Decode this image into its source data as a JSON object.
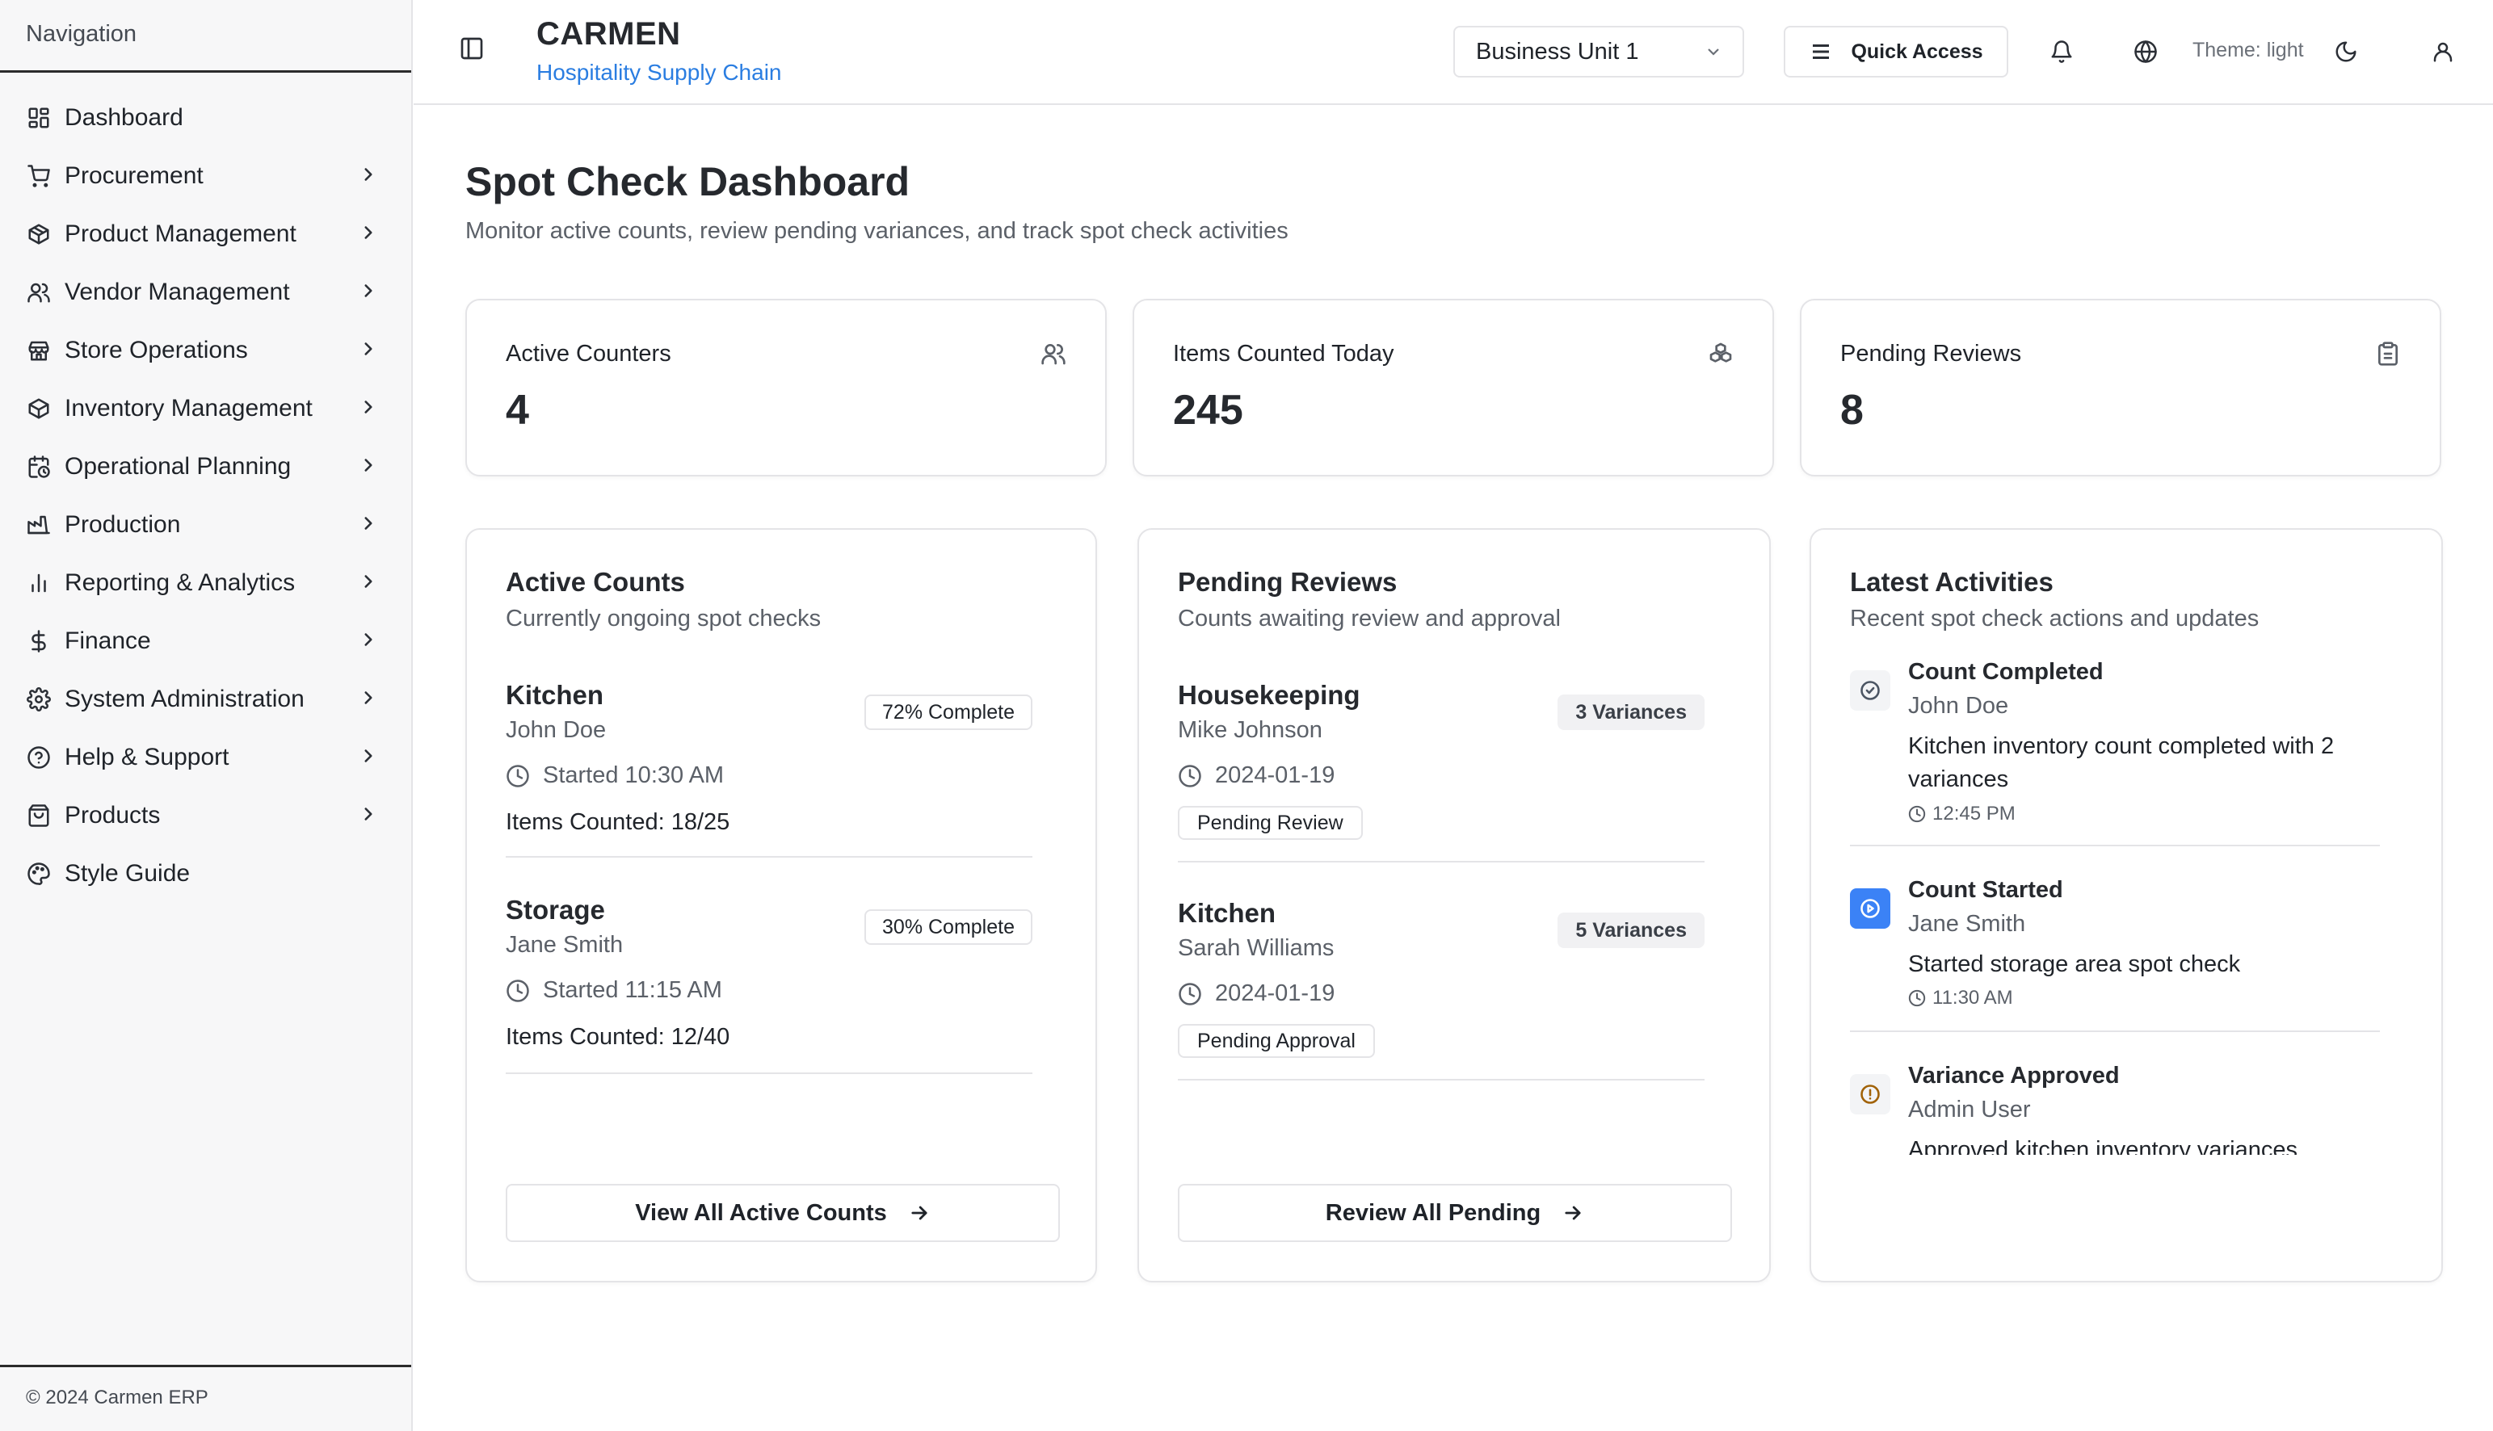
{
  "sidebar": {
    "heading": "Navigation",
    "items": [
      {
        "label": "Dashboard",
        "icon": "dashboard-icon",
        "chevron": false
      },
      {
        "label": "Procurement",
        "icon": "cart-icon",
        "chevron": true
      },
      {
        "label": "Product Management",
        "icon": "package-icon",
        "chevron": true
      },
      {
        "label": "Vendor Management",
        "icon": "users-icon",
        "chevron": true
      },
      {
        "label": "Store Operations",
        "icon": "store-icon",
        "chevron": true
      },
      {
        "label": "Inventory Management",
        "icon": "package-icon",
        "chevron": true
      },
      {
        "label": "Operational Planning",
        "icon": "calendar-clock-icon",
        "chevron": true
      },
      {
        "label": "Production",
        "icon": "factory-icon",
        "chevron": true
      },
      {
        "label": "Reporting & Analytics",
        "icon": "bar-chart-icon",
        "chevron": true
      },
      {
        "label": "Finance",
        "icon": "dollar-icon",
        "chevron": true
      },
      {
        "label": "System Administration",
        "icon": "gear-icon",
        "chevron": true
      },
      {
        "label": "Help & Support",
        "icon": "help-circle-icon",
        "chevron": true
      },
      {
        "label": "Products",
        "icon": "shopping-bag-icon",
        "chevron": true
      },
      {
        "label": "Style Guide",
        "icon": "palette-icon",
        "chevron": false
      }
    ],
    "footer": "© 2024 Carmen ERP"
  },
  "header": {
    "brand": "CARMEN",
    "subtitle": "Hospitality Supply Chain",
    "business_unit": "Business Unit 1",
    "quick_access": "Quick Access",
    "theme_label": "Theme: light"
  },
  "page": {
    "title": "Spot Check Dashboard",
    "subtitle": "Monitor active counts, review pending variances, and track spot check activities"
  },
  "stats": [
    {
      "label": "Active Counters",
      "value": "4",
      "icon": "users-icon"
    },
    {
      "label": "Items Counted Today",
      "value": "245",
      "icon": "boxes-icon"
    },
    {
      "label": "Pending Reviews",
      "value": "8",
      "icon": "clipboard-icon"
    }
  ],
  "active_counts": {
    "title": "Active Counts",
    "subtitle": "Currently ongoing spot checks",
    "items": [
      {
        "location": "Kitchen",
        "person": "John Doe",
        "started": "Started 10:30 AM",
        "counted": "Items Counted: 18/25",
        "progress": "72% Complete"
      },
      {
        "location": "Storage",
        "person": "Jane Smith",
        "started": "Started 11:15 AM",
        "counted": "Items Counted: 12/40",
        "progress": "30% Complete"
      }
    ],
    "button": "View All Active Counts"
  },
  "pending_reviews": {
    "title": "Pending Reviews",
    "subtitle": "Counts awaiting review and approval",
    "items": [
      {
        "location": "Housekeeping",
        "person": "Mike Johnson",
        "date": "2024-01-19",
        "variances": "3 Variances",
        "status": "Pending Review"
      },
      {
        "location": "Kitchen",
        "person": "Sarah Williams",
        "date": "2024-01-19",
        "variances": "5 Variances",
        "status": "Pending Approval"
      }
    ],
    "button": "Review All Pending"
  },
  "latest_activities": {
    "title": "Latest Activities",
    "subtitle": "Recent spot check actions and updates",
    "items": [
      {
        "title": "Count Completed",
        "user": "John Doe",
        "description": "Kitchen inventory count completed with 2 variances",
        "time": "12:45 PM",
        "icon": "check-circle-icon",
        "color": "#4b5563"
      },
      {
        "title": "Count Started",
        "user": "Jane Smith",
        "description": "Started storage area spot check",
        "time": "11:30 AM",
        "icon": "play-circle-icon",
        "color": "#2563eb"
      },
      {
        "title": "Variance Approved",
        "user": "Admin User",
        "description": "Approved kitchen inventory variances",
        "time": "",
        "icon": "alert-circle-icon",
        "color": "#a16207"
      }
    ]
  }
}
